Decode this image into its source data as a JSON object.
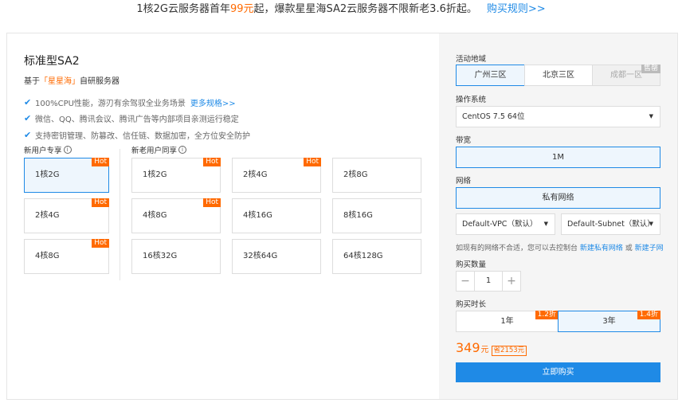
{
  "banner": {
    "text_a": "1核2G云服务器首年",
    "price": "99元",
    "text_b": "起，爆款星星海SA2云服务器不限新老3.6折起。",
    "link": "购买规则>>"
  },
  "product": {
    "title": "标准型SA2",
    "subtitle_prefix": "基于",
    "subtitle_brand": "「星星海」",
    "subtitle_suffix": "自研服务器",
    "features": [
      {
        "text": "100%CPU性能，游刃有余驾驭全业务场景",
        "link": "更多规格>>"
      },
      {
        "text": "微信、QQ、腾讯会议、腾讯广告等内部项目亲测运行稳定",
        "link": ""
      },
      {
        "text": "支持密钥管理、防篡改、信任链、数据加密，全方位安全防护",
        "link": ""
      }
    ]
  },
  "groups": {
    "new_user": {
      "label": "新用户专享",
      "options": [
        {
          "label": "1核2G",
          "hot": "Hot"
        },
        {
          "label": "2核4G",
          "hot": "Hot"
        },
        {
          "label": "4核8G",
          "hot": "Hot"
        }
      ]
    },
    "all_user": {
      "label": "新老用户同享",
      "options": [
        {
          "label": "1核2G",
          "hot": "Hot"
        },
        {
          "label": "2核4G",
          "hot": "Hot"
        },
        {
          "label": "2核8G",
          "hot": ""
        },
        {
          "label": "4核8G",
          "hot": "Hot"
        },
        {
          "label": "4核16G",
          "hot": ""
        },
        {
          "label": "8核16G",
          "hot": ""
        },
        {
          "label": "16核32G",
          "hot": ""
        },
        {
          "label": "32核64G",
          "hot": ""
        },
        {
          "label": "64核128G",
          "hot": ""
        }
      ]
    }
  },
  "config": {
    "region_label": "活动地域",
    "regions": [
      {
        "label": "广州三区",
        "state": "selected"
      },
      {
        "label": "北京三区",
        "state": "normal"
      },
      {
        "label": "成都一区",
        "state": "disabled",
        "tag": "售罄"
      }
    ],
    "os_label": "操作系统",
    "os_value": "CentOS 7.5 64位",
    "bandwidth_label": "带宽",
    "bandwidth_value": "1M",
    "network_label": "网络",
    "network_value": "私有网络",
    "vpc_value": "Default-VPC（默认）",
    "subnet_value": "Default-Subnet（默认）",
    "hint_text": "如现有的网络不合适，您可以去控制台",
    "hint_link1": "新建私有网络",
    "hint_or": "或",
    "hint_link2": "新建子网",
    "quantity_label": "购买数量",
    "quantity_value": "1",
    "duration_label": "购买时长",
    "durations": [
      {
        "label": "1年",
        "tag": "1.2折"
      },
      {
        "label": "3年",
        "tag": "1.4折"
      }
    ],
    "price_value": "349",
    "price_unit": "元",
    "price_save": "省2153元",
    "buy_label": "立即购买"
  },
  "colors": {
    "accent": "#1f8ae6",
    "highlight": "#ff6a00",
    "panel_bg": "#f5f5f5"
  }
}
